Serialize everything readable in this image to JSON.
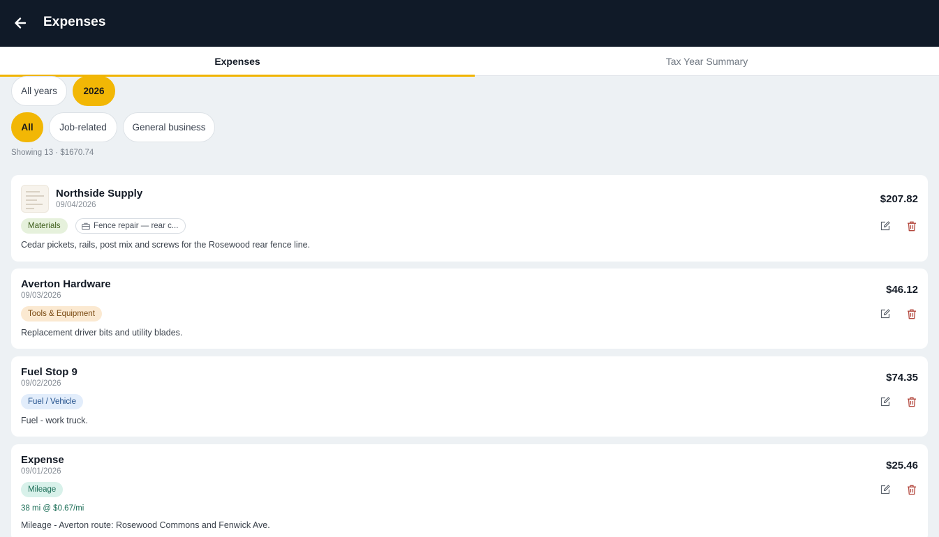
{
  "header": {
    "title": "Expenses",
    "back_icon": "arrow-left-icon"
  },
  "tabs": [
    {
      "label": "Expenses",
      "active": true
    },
    {
      "label": "Tax Year Summary",
      "active": false
    }
  ],
  "year_filters": [
    {
      "label": "All years",
      "selected": false
    },
    {
      "label": "2026",
      "selected": true
    }
  ],
  "category_filters": [
    {
      "label": "All",
      "selected": true
    },
    {
      "label": "Job-related",
      "selected": false
    },
    {
      "label": "General business",
      "selected": false
    }
  ],
  "summary": "Showing 13 · $1670.74",
  "colors": {
    "accent": "#f2b705",
    "header_bg": "#101a28",
    "delete": "#b3473d"
  },
  "expenses": [
    {
      "vendor": "Northside Supply",
      "date": "09/04/2026",
      "amount": "$207.82",
      "category": "Materials",
      "job": "Fence repair — rear c...",
      "description": "Cedar pickets, rails, post mix and screws for the Rosewood rear fence line.",
      "has_receipt": true
    },
    {
      "vendor": "Averton Hardware",
      "date": "09/03/2026",
      "amount": "$46.12",
      "category": "Tools & Equipment",
      "description": "Replacement driver bits and utility blades."
    },
    {
      "vendor": "Fuel Stop 9",
      "date": "09/02/2026",
      "amount": "$74.35",
      "category": "Fuel / Vehicle",
      "description": "Fuel - work truck."
    },
    {
      "vendor": "Expense",
      "date": "09/01/2026",
      "amount": "$25.46",
      "category": "Mileage",
      "mileage": "38 mi @ $0.67/mi",
      "description": "Mileage - Averton route: Rosewood Commons and Fenwick Ave."
    }
  ]
}
